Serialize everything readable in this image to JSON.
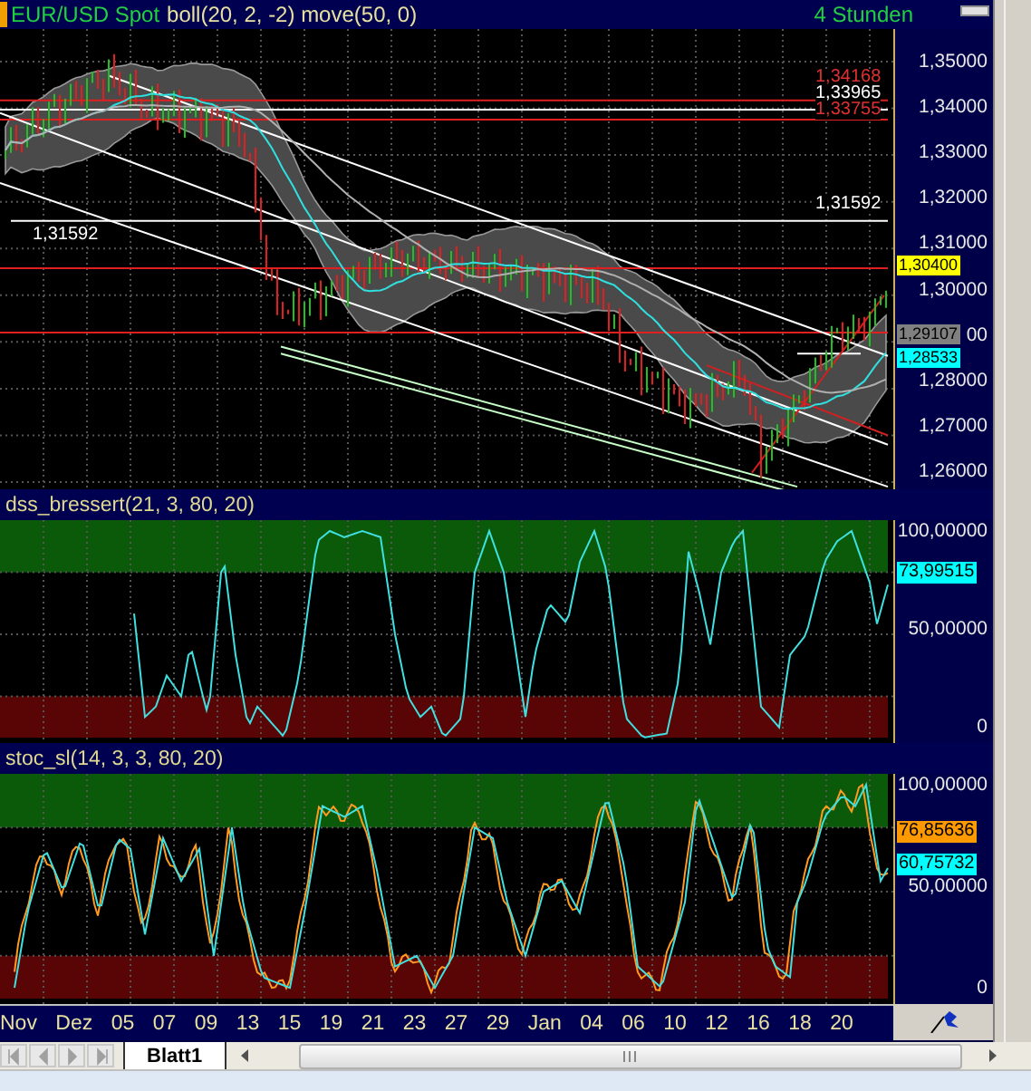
{
  "window": {
    "title": "EUR/USD Spot",
    "indicators": "boll(20, 2, -2) move(50, 0)",
    "timeframe": "4 Stunden"
  },
  "panels": [
    {
      "kind": "price",
      "axis_labels": [
        "1,35000",
        "1,34000",
        "1,33000",
        "1,32000",
        "1,31000",
        "1,30000",
        "00",
        "1,28000",
        "1,27000",
        "1,26000"
      ],
      "line_labels": [
        {
          "text": "1,34168",
          "color": "#e03030"
        },
        {
          "text": "1,33965",
          "color": "#ffffff"
        },
        {
          "text": "1,33755",
          "color": "#e03030"
        },
        {
          "text": "1,31592",
          "color": "#ffffff"
        },
        {
          "text": "1,31592",
          "color": "#ffffff"
        }
      ],
      "markers": [
        {
          "text": "1,30400",
          "color": "#ffff00"
        },
        {
          "text": "1,29107",
          "color": "#808080"
        },
        {
          "text": "1,28533",
          "color": "#00ffff"
        }
      ]
    },
    {
      "kind": "oscillator",
      "title": "dss_bressert(21, 3, 80, 20)",
      "axis_labels": [
        "100,00000",
        "50,00000",
        "0"
      ],
      "markers": [
        {
          "text": "73,99515",
          "color": "#00ffff"
        }
      ]
    },
    {
      "kind": "oscillator",
      "title": "stoc_sl(14, 3, 3, 80, 20)",
      "axis_labels": [
        "100,00000",
        "50,00000",
        "0"
      ],
      "markers": [
        {
          "text": "76,85636",
          "color": "#ff9900"
        },
        {
          "text": "60,75732",
          "color": "#00ffff"
        }
      ]
    }
  ],
  "dates": [
    "Nov",
    "Dez",
    "05",
    "07",
    "09",
    "13",
    "15",
    "19",
    "21",
    "23",
    "27",
    "29",
    "Jan",
    "04",
    "06",
    "10",
    "12",
    "16",
    "18",
    "20"
  ],
  "sheet_tabs": [
    {
      "label": "Blatt1",
      "selected": true
    }
  ]
}
